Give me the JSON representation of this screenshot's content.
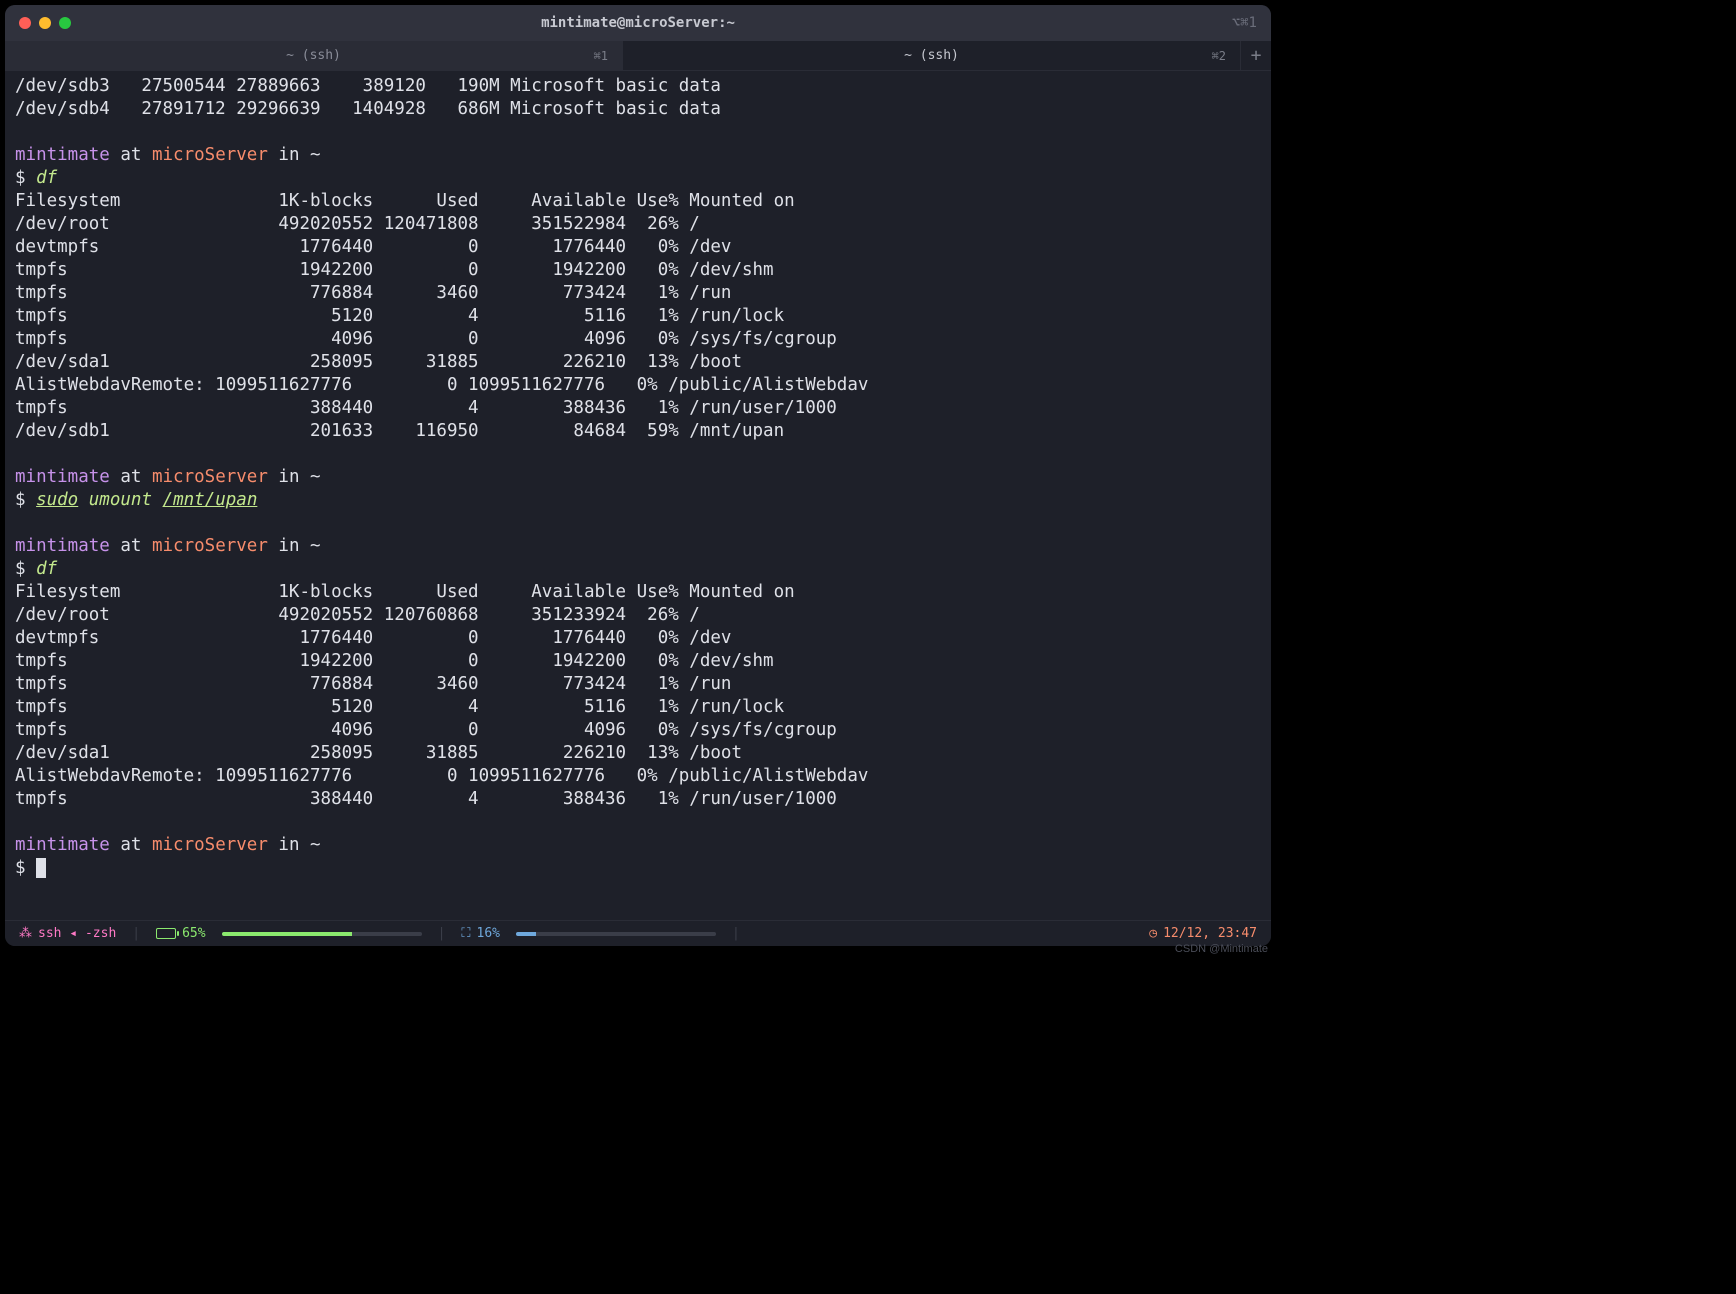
{
  "window": {
    "title": "mintimate@microServer:~",
    "right_icons": "⌥⌘1"
  },
  "tabs": [
    {
      "label": "~ (ssh)",
      "shortcut": "⌘1"
    },
    {
      "label": "~ (ssh)",
      "shortcut": "⌘2"
    }
  ],
  "newtab": "+",
  "partitions": [
    "/dev/sdb3   27500544 27889663    389120   190M Microsoft basic data",
    "/dev/sdb4   27891712 29296639   1404928   686M Microsoft basic data"
  ],
  "prompt1": {
    "user": "mintimate",
    "at": " at ",
    "host": "microServer",
    "in": " in ",
    "path": "~"
  },
  "cmd1": "df",
  "df1_header": "Filesystem               1K-blocks      Used     Available Use% Mounted on",
  "df1": [
    "/dev/root                492020552 120471808     351522984  26% /",
    "devtmpfs                   1776440         0       1776440   0% /dev",
    "tmpfs                      1942200         0       1942200   0% /dev/shm",
    "tmpfs                       776884      3460        773424   1% /run",
    "tmpfs                         5120         4          5116   1% /run/lock",
    "tmpfs                         4096         0          4096   0% /sys/fs/cgroup",
    "/dev/sda1                   258095     31885        226210  13% /boot",
    "AlistWebdavRemote: 1099511627776         0 1099511627776   0% /public/AlistWebdav",
    "tmpfs                       388440         4        388436   1% /run/user/1000",
    "/dev/sdb1                   201633    116950         84684  59% /mnt/upan"
  ],
  "prompt2": {
    "user": "mintimate",
    "at": " at ",
    "host": "microServer",
    "in": " in ",
    "path": "~"
  },
  "cmd2": {
    "sudo": "sudo",
    "rest": " umount ",
    "path": "/mnt/upan"
  },
  "prompt3": {
    "user": "mintimate",
    "at": " at ",
    "host": "microServer",
    "in": " in ",
    "path": "~"
  },
  "cmd3": "df",
  "df2_header": "Filesystem               1K-blocks      Used     Available Use% Mounted on",
  "df2": [
    "/dev/root                492020552 120760868     351233924  26% /",
    "devtmpfs                   1776440         0       1776440   0% /dev",
    "tmpfs                      1942200         0       1942200   0% /dev/shm",
    "tmpfs                       776884      3460        773424   1% /run",
    "tmpfs                         5120         4          5116   1% /run/lock",
    "tmpfs                         4096         0          4096   0% /sys/fs/cgroup",
    "/dev/sda1                   258095     31885        226210  13% /boot",
    "AlistWebdavRemote: 1099511627776         0 1099511627776   0% /public/AlistWebdav",
    "tmpfs                       388440         4        388436   1% /run/user/1000"
  ],
  "prompt4": {
    "user": "mintimate",
    "at": " at ",
    "host": "microServer",
    "in": " in ",
    "path": "~"
  },
  "dollar": "$ ",
  "status": {
    "left_icon": "⁂",
    "left": "ssh ◂ -zsh",
    "battery": "65%",
    "cpu_icon": "⛶",
    "cpu": "16%",
    "clock_icon": "◷",
    "clock": "12/12, 23:47"
  },
  "watermark": "CSDN @Mintimate"
}
